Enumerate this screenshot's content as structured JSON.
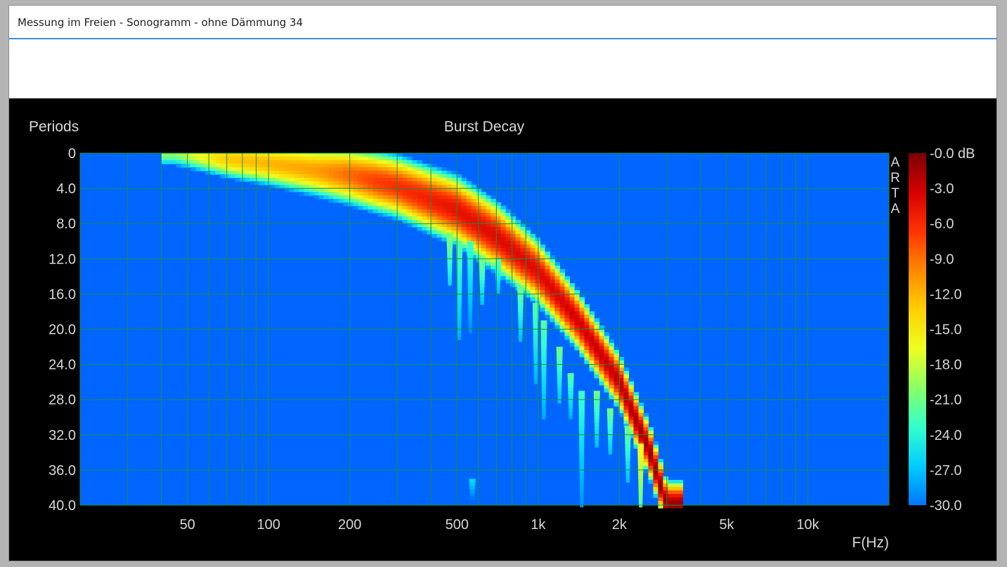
{
  "window": {
    "title": "Messung im Freien - Sonogramm - ohne Dämmung 34"
  },
  "chart_data": {
    "type": "heatmap",
    "title": "Burst Decay",
    "xlabel": "F(Hz)",
    "ylabel": "Periods",
    "watermark": "ARTA",
    "x_scale": "log",
    "xlim": [
      20,
      20000
    ],
    "ylim": [
      0,
      40
    ],
    "y_inverted": true,
    "x_ticks": [
      {
        "value": 50,
        "label": "50"
      },
      {
        "value": 100,
        "label": "100"
      },
      {
        "value": 200,
        "label": "200"
      },
      {
        "value": 500,
        "label": "500"
      },
      {
        "value": 1000,
        "label": "1k"
      },
      {
        "value": 2000,
        "label": "2k"
      },
      {
        "value": 5000,
        "label": "5k"
      },
      {
        "value": 10000,
        "label": "10k"
      }
    ],
    "y_ticks": [
      {
        "value": 0,
        "label": "0"
      },
      {
        "value": 4,
        "label": "4.0"
      },
      {
        "value": 8,
        "label": "8.0"
      },
      {
        "value": 12,
        "label": "12.0"
      },
      {
        "value": 16,
        "label": "16.0"
      },
      {
        "value": 20,
        "label": "20.0"
      },
      {
        "value": 24,
        "label": "24.0"
      },
      {
        "value": 28,
        "label": "28.0"
      },
      {
        "value": 32,
        "label": "32.0"
      },
      {
        "value": 36,
        "label": "36.0"
      },
      {
        "value": 40,
        "label": "40.0"
      }
    ],
    "colorbar": {
      "min": -30,
      "max": 0,
      "unit": "dB",
      "labels": [
        "-0.0 dB",
        "-3.0",
        "-6.0",
        "-9.0",
        "-12.0",
        "-15.0",
        "-18.0",
        "-21.0",
        "-24.0",
        "-27.0",
        "-30.0"
      ],
      "colors": [
        "#7a0000",
        "#d70000",
        "#ff3300",
        "#ff8800",
        "#ffd000",
        "#eeff22",
        "#88ff66",
        "#33ffcc",
        "#00ccff",
        "#0077ff"
      ]
    },
    "grid": true,
    "grid_color": "#1e8c46",
    "background_color": "#0066ff",
    "ridge": [
      {
        "x": 45,
        "periods": 0
      },
      {
        "x": 100,
        "periods": 1.2
      },
      {
        "x": 200,
        "periods": 2.5
      },
      {
        "x": 300,
        "periods": 3.8
      },
      {
        "x": 500,
        "periods": 6.5
      },
      {
        "x": 700,
        "periods": 9.5
      },
      {
        "x": 1000,
        "periods": 13.5
      },
      {
        "x": 1400,
        "periods": 19
      },
      {
        "x": 2000,
        "periods": 26
      },
      {
        "x": 2600,
        "periods": 34
      },
      {
        "x": 3000,
        "periods": 40
      }
    ],
    "band_width_periods": [
      {
        "x": 45,
        "width": 2.4
      },
      {
        "x": 100,
        "width": 3.3
      },
      {
        "x": 200,
        "width": 4.2
      },
      {
        "x": 300,
        "width": 4.3
      },
      {
        "x": 500,
        "width": 4.6
      },
      {
        "x": 700,
        "width": 4.6
      },
      {
        "x": 1000,
        "width": 4.2
      },
      {
        "x": 1400,
        "width": 3.8
      },
      {
        "x": 2000,
        "width": 3.5
      },
      {
        "x": 2600,
        "width": 3.3
      },
      {
        "x": 3000,
        "width": 3.0
      }
    ],
    "peak_levels_db": [
      {
        "x": 45,
        "db": -20
      },
      {
        "x": 70,
        "db": -13
      },
      {
        "x": 150,
        "db": -11
      },
      {
        "x": 250,
        "db": -7
      },
      {
        "x": 500,
        "db": -4.5
      },
      {
        "x": 700,
        "db": -4
      },
      {
        "x": 1000,
        "db": -4
      },
      {
        "x": 2000,
        "db": -2.5
      },
      {
        "x": 2600,
        "db": -1
      },
      {
        "x": 3000,
        "db": -1
      }
    ],
    "tails": [
      {
        "x": 470,
        "from": 9,
        "to": 15,
        "db": -20
      },
      {
        "x": 510,
        "from": 10,
        "to": 21,
        "db": -22
      },
      {
        "x": 560,
        "from": 10,
        "to": 20,
        "db": -23
      },
      {
        "x": 620,
        "from": 12,
        "to": 17,
        "db": -21
      },
      {
        "x": 710,
        "from": 12,
        "to": 16,
        "db": -22
      },
      {
        "x": 860,
        "from": 15,
        "to": 21,
        "db": -21
      },
      {
        "x": 980,
        "from": 17,
        "to": 26,
        "db": -22
      },
      {
        "x": 1050,
        "from": 19,
        "to": 30,
        "db": -22
      },
      {
        "x": 1200,
        "from": 22,
        "to": 28,
        "db": -21
      },
      {
        "x": 1320,
        "from": 25,
        "to": 30,
        "db": -22
      },
      {
        "x": 1450,
        "from": 27,
        "to": 40,
        "db": -23
      },
      {
        "x": 1650,
        "from": 27,
        "to": 33,
        "db": -21
      },
      {
        "x": 1850,
        "from": 29,
        "to": 34,
        "db": -21
      },
      {
        "x": 2150,
        "from": 31,
        "to": 37,
        "db": -21
      },
      {
        "x": 2400,
        "from": 33,
        "to": 40,
        "db": -16
      },
      {
        "x": 570,
        "from": 37,
        "to": 40,
        "db": -26
      }
    ]
  }
}
